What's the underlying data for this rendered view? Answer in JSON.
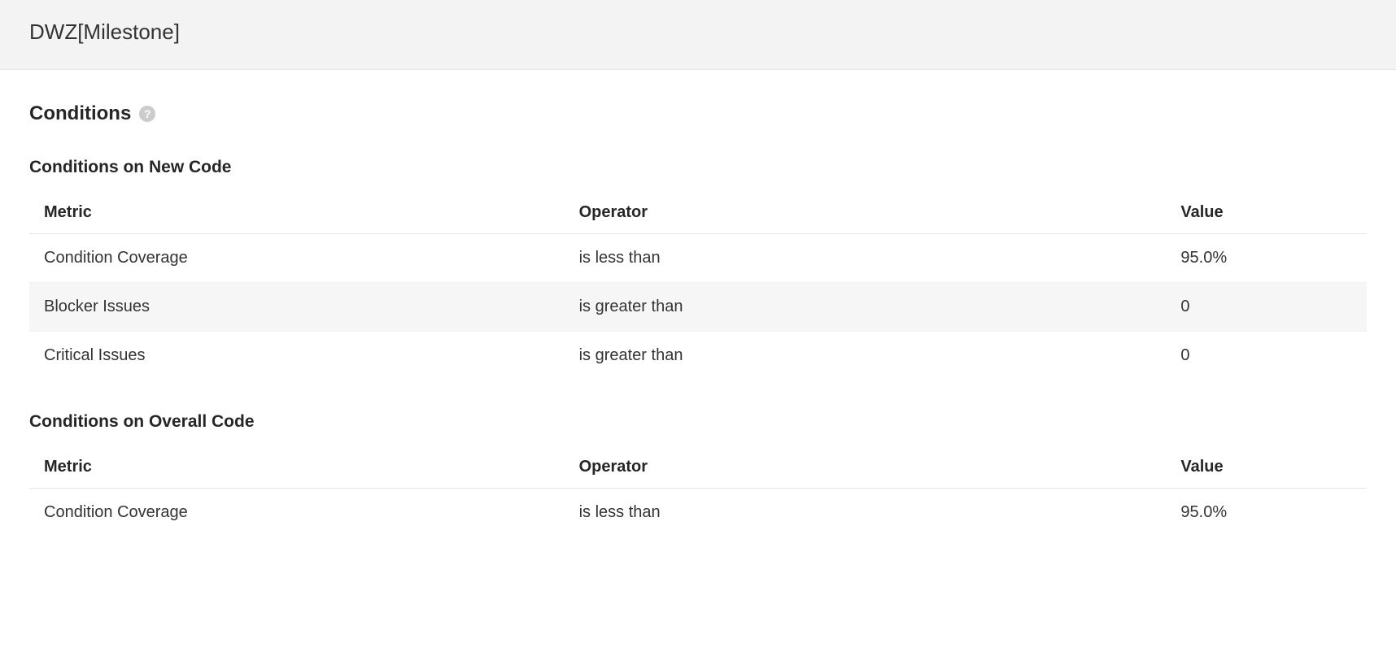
{
  "header": {
    "title": "DWZ[Milestone]"
  },
  "sections": {
    "conditions": {
      "title": "Conditions",
      "columns": {
        "metric": "Metric",
        "operator": "Operator",
        "value": "Value"
      },
      "new_code": {
        "title": "Conditions on New Code",
        "rows": [
          {
            "metric": "Condition Coverage",
            "operator": "is less than",
            "value": "95.0%"
          },
          {
            "metric": "Blocker Issues",
            "operator": "is greater than",
            "value": "0"
          },
          {
            "metric": "Critical Issues",
            "operator": "is greater than",
            "value": "0"
          }
        ]
      },
      "overall_code": {
        "title": "Conditions on Overall Code",
        "rows": [
          {
            "metric": "Condition Coverage",
            "operator": "is less than",
            "value": "95.0%"
          }
        ]
      }
    }
  }
}
